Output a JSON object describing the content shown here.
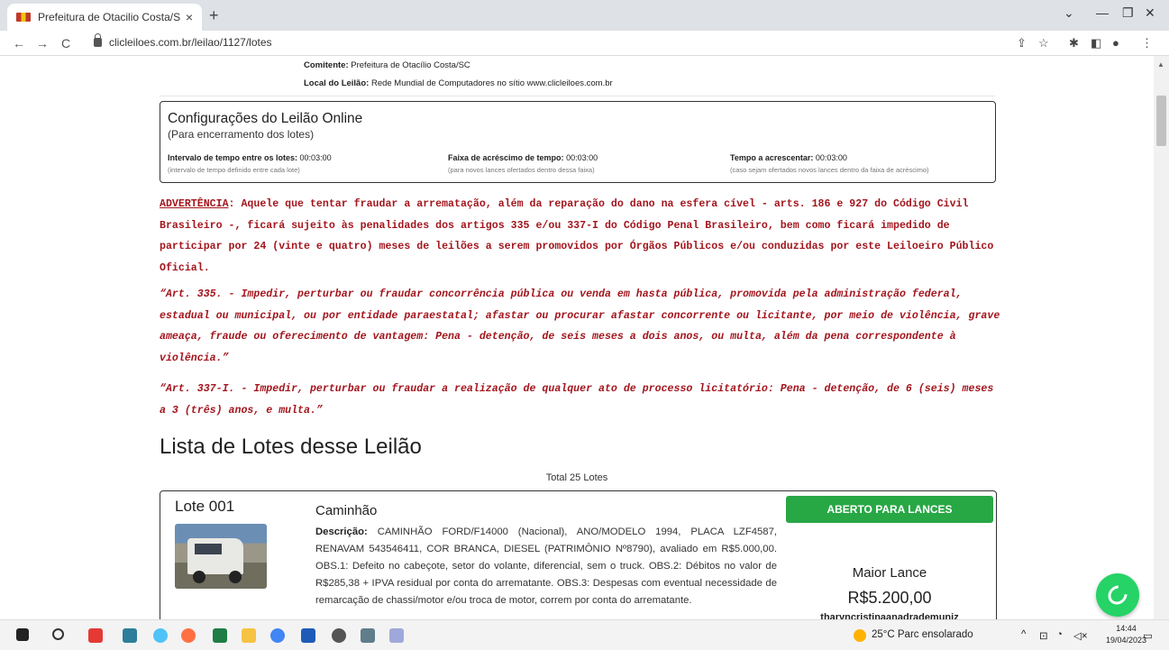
{
  "browser": {
    "tab_title": "Prefeitura de Otacilio Costa/SC :",
    "tab_close": "×",
    "new_tab": "+",
    "url": "clicleiloes.com.br/leilao/1127/lotes",
    "nav_back": "←",
    "nav_forward": "→",
    "nav_reload": "C"
  },
  "header_meta": {
    "comitente_label": "Comitente:",
    "comitente_value": "Prefeitura de Otacílio Costa/SC",
    "local_label": "Local do Leilão:",
    "local_value": "Rede Mundial de Computadores no sítio www.clicleiloes.com.br"
  },
  "config": {
    "title": "Configurações do Leilão Online",
    "subtitle": "(Para encerramento dos lotes)",
    "items": [
      {
        "label": "Intervalo de tempo entre os lotes:",
        "value": "00:03:00",
        "hint": "(intervalo de tempo definido entre cada lote)"
      },
      {
        "label": "Faixa de acréscimo de tempo:",
        "value": "00:03:00",
        "hint": "(para novos lances ofertados dentro dessa faixa)"
      },
      {
        "label": "Tempo a acrescentar:",
        "value": "00:03:00",
        "hint": "(caso sejam ofertados novos lances dentro da faixa de acréscimo)"
      }
    ]
  },
  "warning": {
    "prefix": "ADVERTÊNCIA",
    "text": ": Aquele que tentar fraudar a arrematação, além da reparação do dano na esfera cível - arts. 186 e 927 do Código Civil Brasileiro -, ficará sujeito às penalidades dos artigos 335 e/ou 337-I do Código Penal Brasileiro, bem como ficará impedido de participar por 24 (vinte e quatro) meses de leilões a serem promovidos por Órgãos Públicos e/ou conduzidas por este Leiloeiro Público Oficial.",
    "art335": "“Art. 335. - Impedir, perturbar ou fraudar concorrência pública ou venda em hasta pública, promovida pela administração federal, estadual ou municipal, ou por entidade paraestatal; afastar ou procurar afastar concorrente ou licitante, por meio de violência, grave ameaça, fraude ou oferecimento de vantagem: Pena - detenção, de seis meses a dois anos, ou multa, além da pena correspondente à violência.”",
    "art337": "“Art. 337-I. - Impedir, perturbar ou fraudar a realização de qualquer ato de processo licitatório: Pena - detenção, de 6 (seis) meses a 3 (três) anos, e multa.”"
  },
  "lotes": {
    "heading": "Lista de Lotes desse Leilão",
    "total": "Total 25 Lotes",
    "items": [
      {
        "number": "Lote 001",
        "title": "Caminhão",
        "desc_label": "Descrição:",
        "description": "CAMINHÃO FORD/F14000 (Nacional), ANO/MODELO 1994, PLACA LZF4587, RENAVAM 543546411, COR BRANCA, DIESEL (PATRIMÔNIO Nº8790), avaliado em R$5.000,00. OBS.1: Defeito no cabeçote, setor do volante, diferencial, sem o truck. OBS.2: Débitos no valor de R$285,38 + IPVA residual por conta do arrematante. OBS.3: Despesas com eventual necessidade de remarcação de chassi/motor e/ou troca de motor, correm por conta do arrematante.",
        "status": "ABERTO PARA LANCES",
        "maior_lance_label": "Maior Lance",
        "maior_lance_value": "R$5.200,00",
        "maior_lance_user": "tharyncristinaanadrademuniz"
      }
    ]
  },
  "taskbar": {
    "weather": "25°C  Parc ensolarado",
    "time": "14:44",
    "date": "19/04/2023"
  },
  "colors": {
    "warning_red": "#a3151d",
    "status_green": "#28a745",
    "whatsapp_green": "#25d366"
  }
}
